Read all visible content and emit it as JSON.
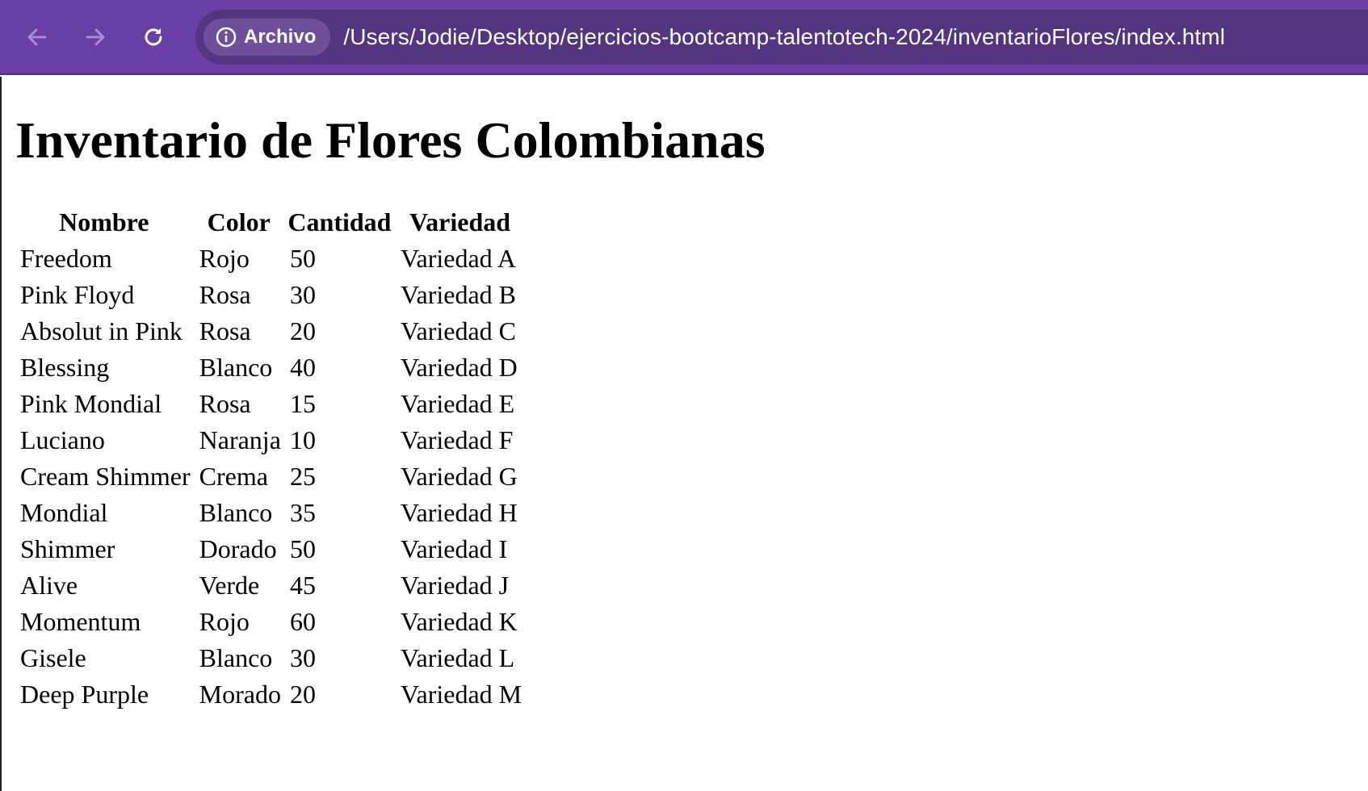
{
  "browser": {
    "nav": {
      "back_icon": "arrow-left-icon",
      "forward_icon": "arrow-right-icon",
      "reload_icon": "reload-icon"
    },
    "site_chip": {
      "icon": "info-circle-icon",
      "label": "Archivo"
    },
    "url": "/Users/Jodie/Desktop/ejercicios-bootcamp-talentotech-2024/inventarioFlores/index.html",
    "colors": {
      "toolbar": "#6a3fa5",
      "address_bar": "#53357f",
      "chip": "#6d4f9b"
    }
  },
  "page": {
    "title": "Inventario de Flores Colombianas",
    "table": {
      "headers": [
        "Nombre",
        "Color",
        "Cantidad",
        "Variedad"
      ],
      "rows": [
        [
          "Freedom",
          "Rojo",
          "50",
          "Variedad A"
        ],
        [
          "Pink Floyd",
          "Rosa",
          "30",
          "Variedad B"
        ],
        [
          "Absolut in Pink",
          "Rosa",
          "20",
          "Variedad C"
        ],
        [
          "Blessing",
          "Blanco",
          "40",
          "Variedad D"
        ],
        [
          "Pink Mondial",
          "Rosa",
          "15",
          "Variedad E"
        ],
        [
          "Luciano",
          "Naranja",
          "10",
          "Variedad F"
        ],
        [
          "Cream Shimmer",
          "Crema",
          "25",
          "Variedad G"
        ],
        [
          "Mondial",
          "Blanco",
          "35",
          "Variedad H"
        ],
        [
          "Shimmer",
          "Dorado",
          "50",
          "Variedad I"
        ],
        [
          "Alive",
          "Verde",
          "45",
          "Variedad J"
        ],
        [
          "Momentum",
          "Rojo",
          "60",
          "Variedad K"
        ],
        [
          "Gisele",
          "Blanco",
          "30",
          "Variedad L"
        ],
        [
          "Deep Purple",
          "Morado",
          "20",
          "Variedad M"
        ]
      ]
    }
  }
}
